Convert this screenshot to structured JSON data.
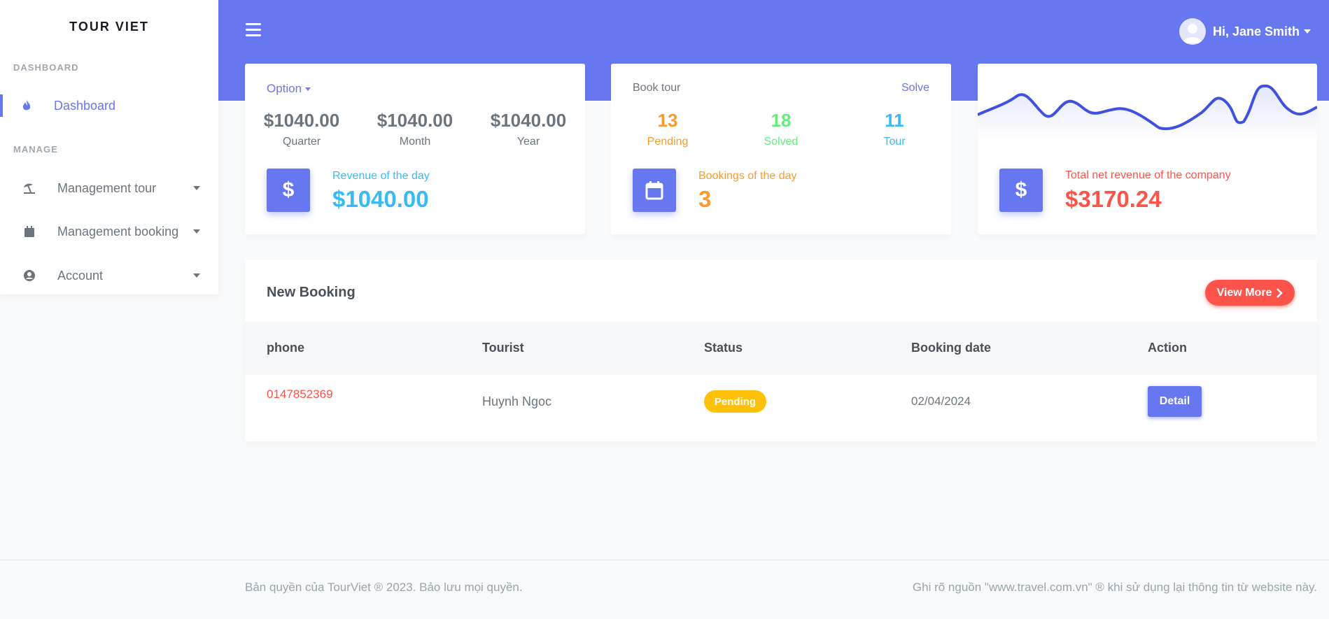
{
  "sidebar": {
    "brand": "TOUR VIET",
    "sections": [
      {
        "header": "DASHBOARD"
      },
      {
        "header": "MANAGE"
      }
    ],
    "items": [
      {
        "label": "Dashboard",
        "icon": "fire-icon",
        "active": true
      },
      {
        "label": "Management tour",
        "icon": "beach-umbrella-icon"
      },
      {
        "label": "Management booking",
        "icon": "calendar-icon"
      },
      {
        "label": "Account",
        "icon": "user-circle-icon"
      }
    ]
  },
  "topbar": {
    "user_greeting": "Hi, Jane Smith"
  },
  "revenue_card": {
    "option_label": "Option",
    "stats": [
      {
        "value": "$1040.00",
        "label": "Quarter"
      },
      {
        "value": "$1040.00",
        "label": "Month"
      },
      {
        "value": "$1040.00",
        "label": "Year"
      }
    ],
    "day_label": "Revenue of the day",
    "day_value": "$1040.00",
    "icon_symbol": "$"
  },
  "booking_card": {
    "title": "Book tour",
    "action_label": "Solve",
    "stats": [
      {
        "value": "13",
        "label": "Pending"
      },
      {
        "value": "18",
        "label": "Solved"
      },
      {
        "value": "11",
        "label": "Tour"
      }
    ],
    "day_label": "Bookings of the day",
    "day_value": "3"
  },
  "net_card": {
    "label": "Total net revenue of the company",
    "value": "$3170.24",
    "icon_symbol": "$"
  },
  "new_booking": {
    "title": "New Booking",
    "view_more": "View More",
    "columns": [
      "phone",
      "Tourist",
      "Status",
      "Booking date",
      "Action"
    ],
    "rows": [
      {
        "phone": "0147852369",
        "tourist": "Huynh Ngoc",
        "status": "Pending",
        "date": "02/04/2024",
        "action": "Detail"
      }
    ]
  },
  "footer": {
    "left": "Bản quyền của TourViet ® 2023. Bảo lưu mọi quyền.",
    "right": "Ghi rõ nguồn \"www.travel.com.vn\" ® khi sử dụng lại thông tin từ website này."
  },
  "colors": {
    "primary": "#6777ef",
    "warning": "#f69c33",
    "success": "#63ed7a",
    "info": "#3abaf4",
    "danger": "#fc544b",
    "badge": "#ffc107"
  }
}
